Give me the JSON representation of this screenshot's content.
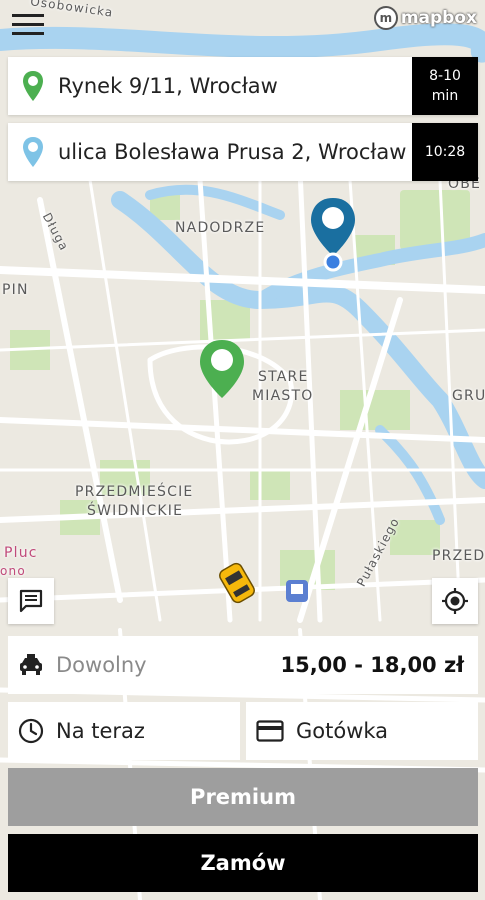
{
  "map": {
    "attribution_logo": "mapbox",
    "labels": {
      "osobowicka": "Osobowicka",
      "nadodrze": "NADODRZE",
      "dluga": "Długa",
      "pin": "PIN",
      "stare_miasto_1": "STARE",
      "stare_miasto_2": "MIASTO",
      "przedmiescie_1": "PRZEDMIEŚCIE",
      "przedmiescie_2": "ŚWIDNICKIE",
      "pulaskiego": "Pułaskiego",
      "obe": "OBE",
      "gru": "GRU",
      "przed": "PRZED",
      "pluc": "Pluc",
      "ono": "ono"
    }
  },
  "route": {
    "from": {
      "address": "Rynek 9/11, Wrocław",
      "eta_line1": "8-10",
      "eta_line2": "min",
      "pin_color": "#4caf50"
    },
    "to": {
      "address": "ulica Bolesława Prusa 2, Wrocław",
      "eta": "10:28",
      "pin_color": "#7ec3e6"
    }
  },
  "order": {
    "car_class": "Dowolny",
    "price": "15,00 - 18,00 zł",
    "time": "Na teraz",
    "payment": "Gotówka",
    "premium_label": "Premium",
    "order_label": "Zamów"
  },
  "colors": {
    "water": "#a9d3f0",
    "park": "#c8e6b0",
    "road": "#ffffff",
    "pickup_pin": "#4caf50",
    "destination_pin": "#1a6fa0"
  },
  "icons": {
    "menu": "hamburger-icon",
    "chat": "chat-icon",
    "locate": "crosshair-icon",
    "car": "car-icon",
    "clock": "clock-icon",
    "card": "credit-card-icon"
  }
}
